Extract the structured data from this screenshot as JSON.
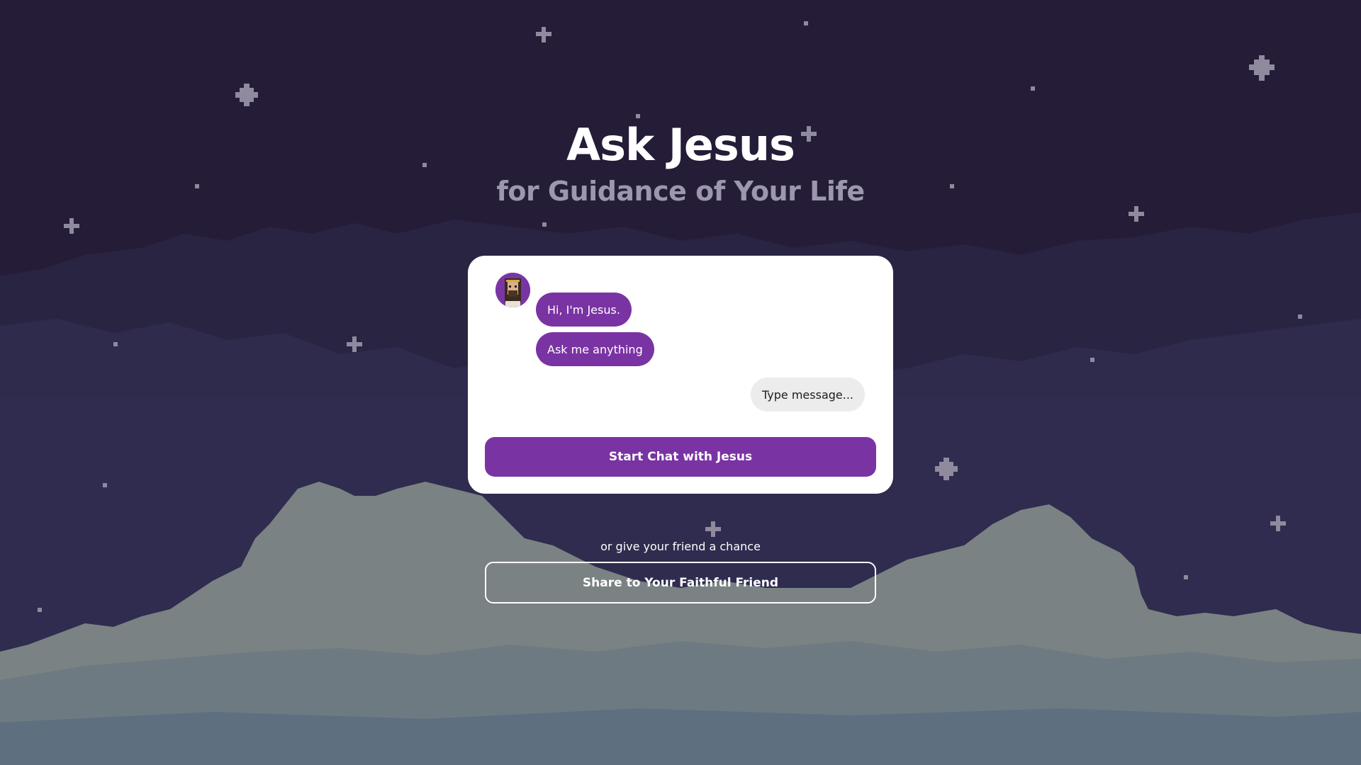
{
  "page": {
    "title": "Ask Jesus",
    "subtitle": "for Guidance of Your Life"
  },
  "chat": {
    "avatar_icon": "jesus-avatar-icon",
    "messages": [
      {
        "from": "jesus",
        "text": "Hi, I'm Jesus."
      },
      {
        "from": "jesus",
        "text": "Ask me anything"
      }
    ],
    "input_placeholder": "Type message...",
    "start_button_label": "Start Chat with Jesus"
  },
  "share": {
    "prompt": "or give your friend a chance",
    "button_label": "Share to Your Faithful Friend"
  },
  "colors": {
    "sky_top": "#251c38",
    "sky_mid": "#2f2a4e",
    "cloud": "#7c8384",
    "accent": "#7a33a3",
    "card": "#ffffff"
  }
}
